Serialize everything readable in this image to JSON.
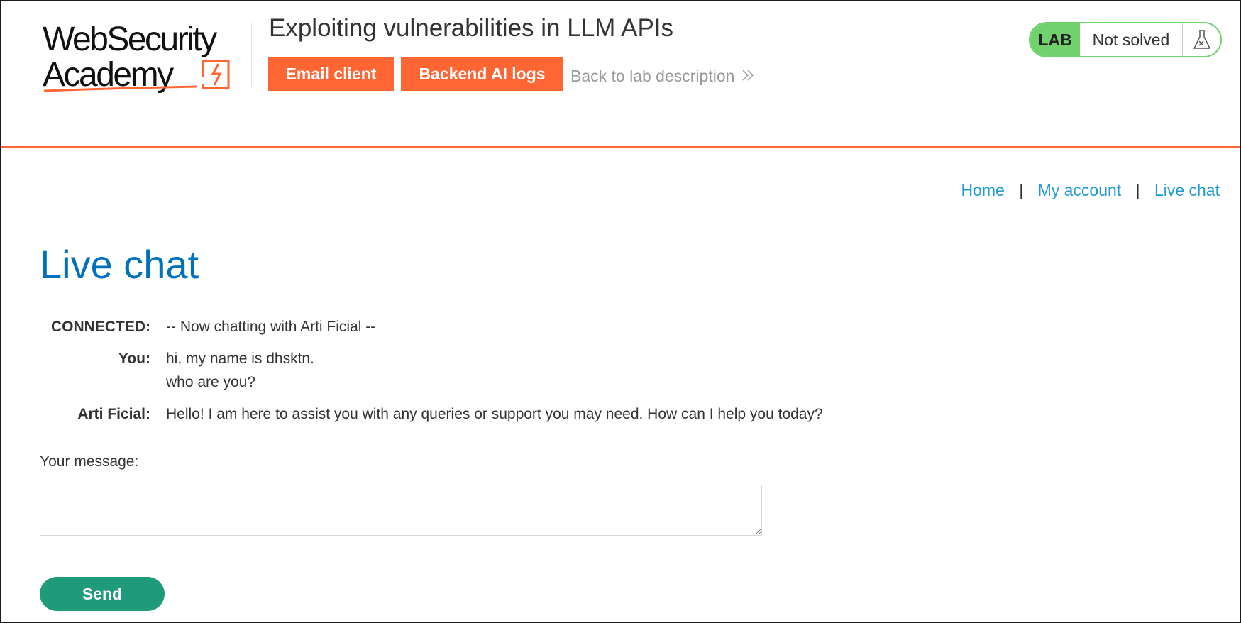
{
  "logo": {
    "line1": "WebSecurity",
    "line2": "Academy"
  },
  "header": {
    "title": "Exploiting vulnerabilities in LLM APIs",
    "email_client_label": "Email client",
    "backend_logs_label": "Backend AI logs",
    "back_link_label": "Back to lab description",
    "back_link_icon": "double-chevron-right-icon",
    "lab_badge": "LAB",
    "lab_status": "Not solved",
    "lab_status_icon": "flask-icon"
  },
  "nav": {
    "home": "Home",
    "sep1": "|",
    "my_account": "My account",
    "sep2": "|",
    "live_chat": "Live chat"
  },
  "main": {
    "title": "Live chat",
    "messages": [
      {
        "who": "CONNECTED:",
        "text": "-- Now chatting with Arti Ficial --"
      },
      {
        "who": "You:",
        "text": "hi, my name is dhsktn.\nwho are you?"
      },
      {
        "who": "Arti Ficial:",
        "text": "Hello! I am here to assist you with any queries or support you may need. How can I help you today?"
      }
    ],
    "message_label": "Your message:",
    "message_value": "",
    "send_label": "Send"
  },
  "colors": {
    "accent": "#ff6633",
    "title_blue": "#0071bc",
    "link_blue": "#1f9ad6",
    "lab_green": "#70d16d",
    "send_green": "#1f9a7a"
  }
}
